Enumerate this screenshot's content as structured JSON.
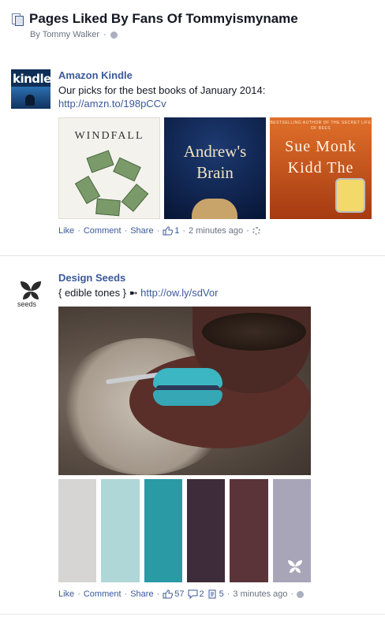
{
  "header": {
    "title": "Pages Liked By Fans Of Tommyismyname",
    "byline": "By Tommy Walker"
  },
  "stories": [
    {
      "page_name": "Amazon Kindle",
      "avatar_text": "kindle",
      "text": "Our picks for the best books of January 2014:",
      "link": "http://amzn.to/198pCCv",
      "books": [
        {
          "title": "WINDFALL"
        },
        {
          "title": "Andrew's Brain"
        },
        {
          "top": "BESTSELLING AUTHOR OF THE SECRET LIFE OF BEES",
          "title": "Sue Monk Kidd The"
        }
      ],
      "actions": {
        "like": "Like",
        "comment": "Comment",
        "share": "Share",
        "likes_count": "1",
        "time": "2 minutes ago"
      }
    },
    {
      "page_name": "Design Seeds",
      "avatar_text": "seeds",
      "text_prefix": "{ edible tones } ➼",
      "link": "http://ow.ly/sdVor",
      "palette_colors": [
        "#d6d5d3",
        "#afd7d7",
        "#2a9aa5",
        "#3e2c3a",
        "#5a3439",
        "#a8a5b8"
      ],
      "actions": {
        "like": "Like",
        "comment": "Comment",
        "share": "Share",
        "likes_count": "57",
        "comments_count": "2",
        "shares_count": "5",
        "time": "3 minutes ago"
      }
    }
  ],
  "icons": {
    "header": "pages-icon",
    "privacy": "globe-icon",
    "like": "thumbs-up-icon",
    "comment": "comment-bubble-icon",
    "share": "share-icon",
    "settings": "gear-icon"
  }
}
